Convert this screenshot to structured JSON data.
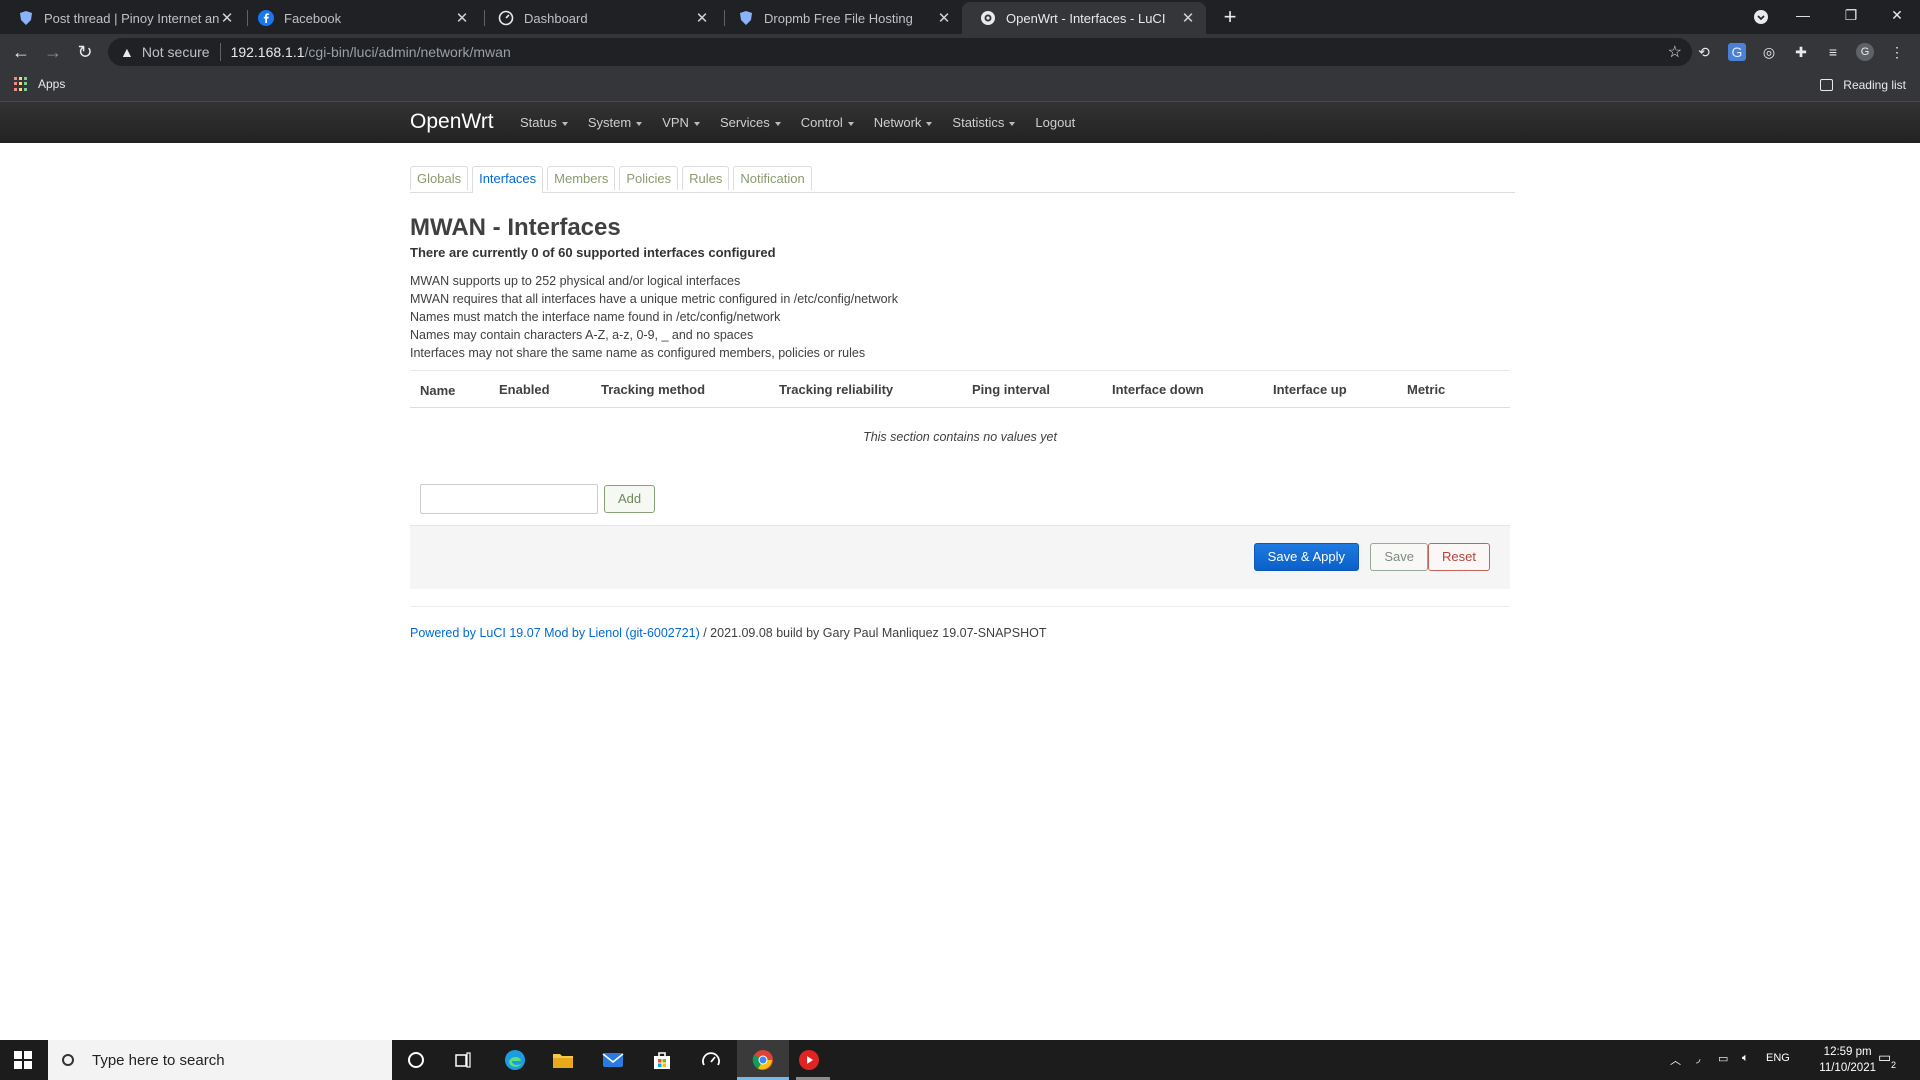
{
  "browser": {
    "tabs": [
      {
        "title": "Post thread | Pinoy Internet and",
        "favicon": "shield-icon",
        "active": false
      },
      {
        "title": "Facebook",
        "favicon": "facebook-icon",
        "active": false
      },
      {
        "title": "Dashboard",
        "favicon": "dashboard-icon",
        "active": false
      },
      {
        "title": "Dropmb Free File Hosting",
        "favicon": "shield-icon",
        "active": false
      },
      {
        "title": "OpenWrt - Interfaces - LuCI",
        "favicon": "globe-icon",
        "active": true
      }
    ],
    "security_label": "Not secure",
    "url_host": "192.168.1.1",
    "url_path": "/cgi-bin/luci/admin/network/mwan",
    "profile_initial": "G",
    "bookmarks": {
      "apps": "Apps",
      "reading_list": "Reading list"
    }
  },
  "navbar": {
    "brand": "OpenWrt",
    "menu": [
      "Status",
      "System",
      "VPN",
      "Services",
      "Control",
      "Network",
      "Statistics",
      "Logout"
    ]
  },
  "tabs": [
    "Globals",
    "Interfaces",
    "Members",
    "Policies",
    "Rules",
    "Notification"
  ],
  "active_tab": "Interfaces",
  "page": {
    "title": "MWAN - Interfaces",
    "summary": "There are currently 0 of 60 supported interfaces configured",
    "description": [
      "MWAN supports up to 252 physical and/or logical interfaces",
      "MWAN requires that all interfaces have a unique metric configured in /etc/config/network",
      "Names must match the interface name found in /etc/config/network",
      "Names may contain characters A-Z, a-z, 0-9, _ and no spaces",
      "Interfaces may not share the same name as configured members, policies or rules"
    ]
  },
  "table": {
    "headers": [
      "Name",
      "Enabled",
      "Tracking method",
      "Tracking reliability",
      "Ping interval",
      "Interface down",
      "Interface up",
      "Metric"
    ],
    "empty_text": "This section contains no values yet"
  },
  "add": {
    "value": "",
    "button": "Add"
  },
  "actions": {
    "save_apply": "Save & Apply",
    "save": "Save",
    "reset": "Reset"
  },
  "footer": {
    "link_text": "Powered by LuCI 19.07 Mod by Lienol (git-6002721)",
    "rest": " / 2021.09.08 build by Gary Paul Manliquez 19.07-SNAPSHOT"
  },
  "taskbar": {
    "search_placeholder": "Type here to search",
    "language": "ENG",
    "time": "12:59 pm",
    "date": "11/10/2021",
    "notification_count": "2"
  },
  "colors": {
    "link": "#0069d6",
    "primary_button": "#0d6efd",
    "navbar": "#222222",
    "reset": "#b4453a"
  }
}
